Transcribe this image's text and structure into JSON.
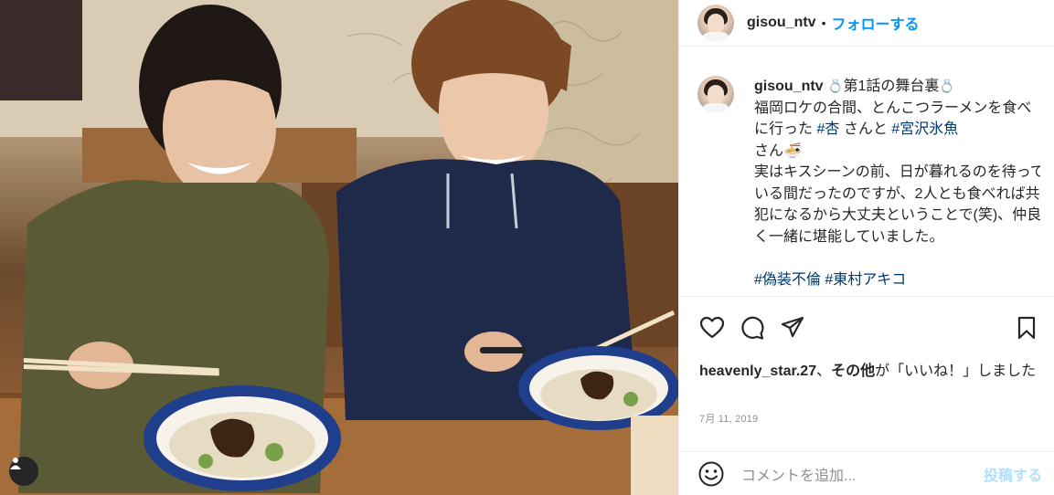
{
  "post": {
    "username": "gisou_ntv",
    "follow_separator": "•",
    "follow_label": "フォローする",
    "caption": {
      "username": "gisou_ntv",
      "ring_emoji": "💍",
      "title": "第1話の舞台裏",
      "line_a": "福岡ロケの合間、とんこつラーメンを食べに行った",
      "tag_1": "#杏",
      "mid": "さんと",
      "tag_2": "#宮沢氷魚",
      "line_b": "さん",
      "ramen_emoji": "🍜",
      "body": "実はキスシーンの前、日が暮れるのを待っている間だったのですが、2人とも食べれば共犯になるから大丈夫ということで(笑)、仲良く一緒に堪能していました。",
      "tags_tail": "#偽装不倫 #東村アキコ"
    },
    "likes": {
      "user": "heavenly_star.27",
      "connector": "、",
      "others": "その他",
      "suffix": "が「いいね！」しました"
    },
    "date": "7月 11, 2019",
    "comment": {
      "placeholder": "コメントを追加...",
      "post_label": "投稿する"
    }
  },
  "icons": {
    "like": "heart-icon",
    "comment": "comment-icon",
    "share": "paper-plane-icon",
    "save": "bookmark-icon",
    "emoji": "smiley-icon",
    "tag": "user-tag-icon"
  },
  "colors": {
    "accent": "#0095f6",
    "hashtag": "#00376b",
    "muted": "#8e8e8e",
    "post_disabled": "#b2dffc"
  }
}
